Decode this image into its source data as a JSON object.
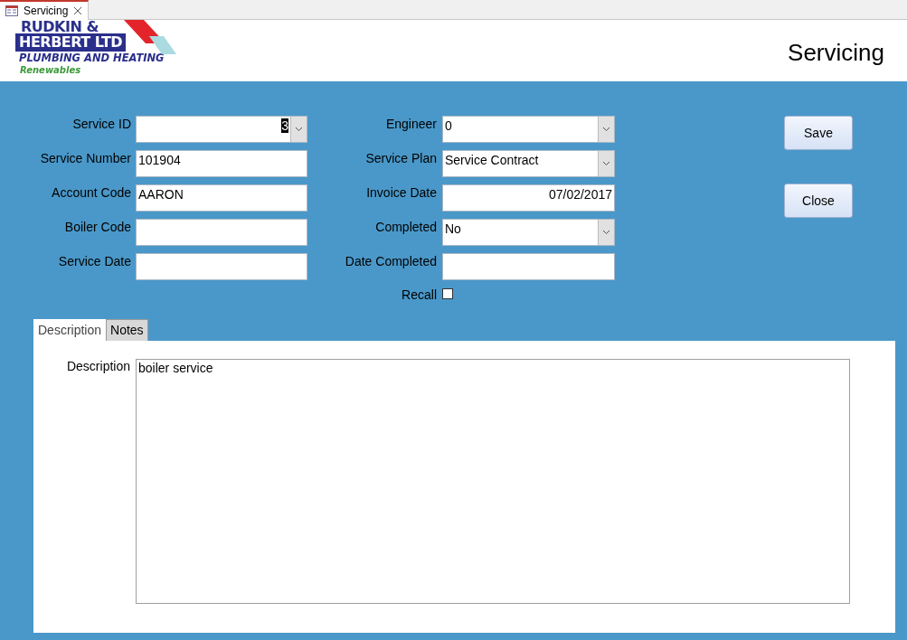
{
  "document_tab": {
    "title": "Servicing"
  },
  "logo": {
    "line_1": "RUDKIN &",
    "line_2": "HERBERT LTD",
    "line_3": "PLUMBING AND HEATING",
    "line_4": "Renewables"
  },
  "form_title": "Servicing",
  "left_fields": [
    {
      "label": "Service ID",
      "kind": "number_combo",
      "value": "3",
      "highlighted": true
    },
    {
      "label": "Service Number",
      "kind": "text",
      "value": "101904"
    },
    {
      "label": "Account Code",
      "kind": "text",
      "value": "AARON"
    },
    {
      "label": "Boiler Code",
      "kind": "text"
    },
    {
      "label": "Service Date",
      "kind": "text"
    }
  ],
  "right_fields": [
    {
      "label": "Engineer",
      "kind": "combo",
      "value": "0"
    },
    {
      "label": "Service Plan",
      "kind": "combo",
      "value": "Service Contract"
    },
    {
      "label": "Invoice Date",
      "kind": "date",
      "value": "07/02/2017"
    },
    {
      "label": "Completed",
      "kind": "combo",
      "value": "No"
    },
    {
      "label": "Date Completed",
      "kind": "text"
    },
    {
      "label": "Recall",
      "kind": "checkbox",
      "checked": false
    }
  ],
  "buttons": [
    "Save",
    "Close"
  ],
  "tabs": [
    {
      "label": "Description",
      "selected": true
    },
    {
      "label": "Notes",
      "selected": false
    }
  ],
  "description": {
    "label": "Description",
    "value": "boiler service"
  }
}
